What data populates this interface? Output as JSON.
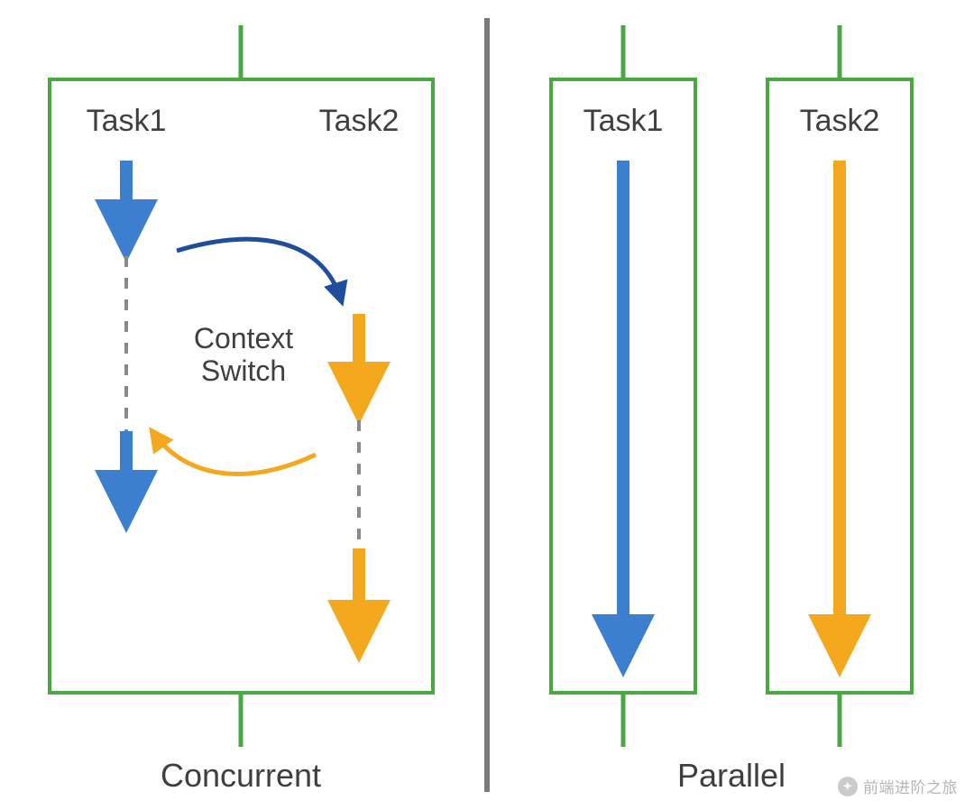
{
  "concurrent": {
    "task1_label": "Task1",
    "task2_label": "Task2",
    "context_label_line1": "Context",
    "context_label_line2": "Switch",
    "caption": "Concurrent"
  },
  "parallel": {
    "task1_label": "Task1",
    "task2_label": "Task2",
    "caption": "Parallel"
  },
  "watermark": "前端进阶之旅",
  "colors": {
    "box_green": "#4aa843",
    "task1_blue": "#3d7fcf",
    "task2_orange": "#f3a81d",
    "context_arrow_blue": "#1f4e9c",
    "context_arrow_orange": "#f3a81d",
    "divider_gray": "#7a7a7a",
    "dash_gray": "#8a8a8a",
    "text": "#3f3f3f"
  }
}
